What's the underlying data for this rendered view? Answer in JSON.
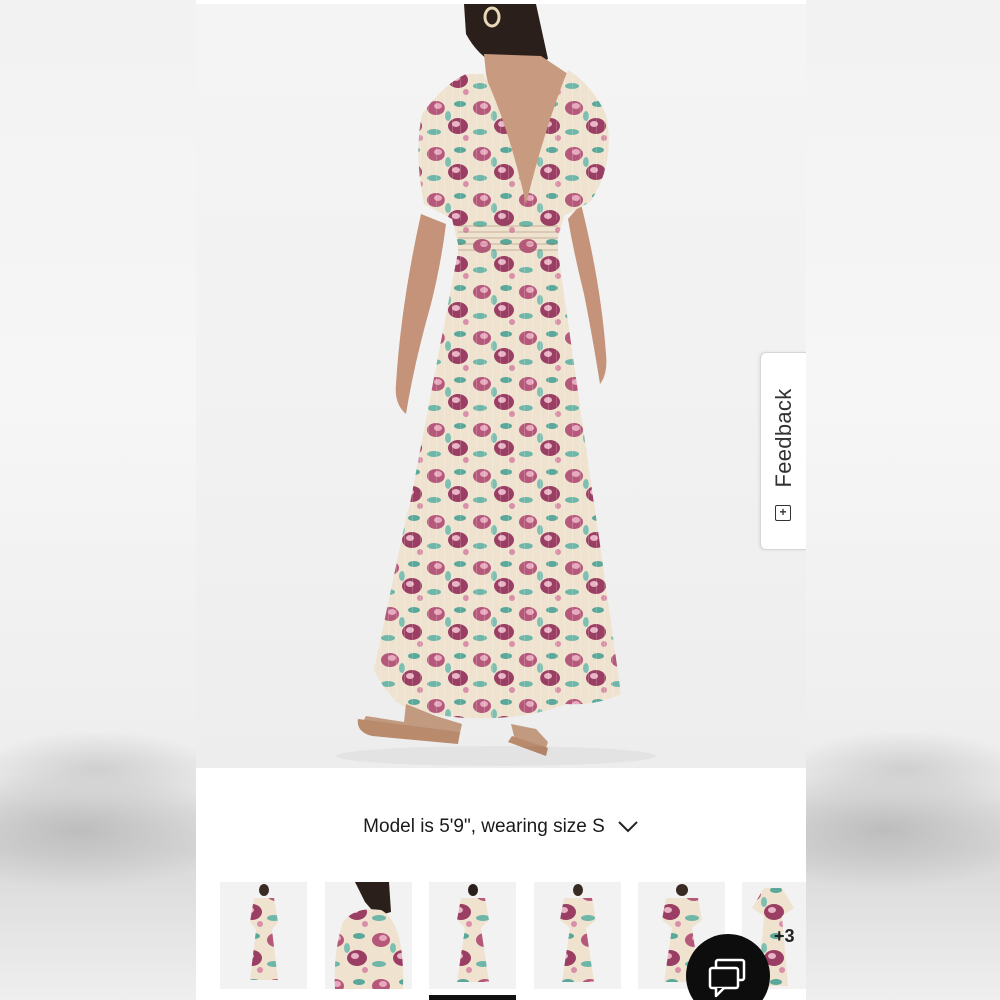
{
  "product_view": {
    "caption": "Model is 5'9\", wearing size S",
    "caption_toggle_icon": "chevron-down-icon",
    "feedback_label": "Feedback",
    "feedback_icon": "plus-square-icon",
    "more_images_badge": "+3",
    "thumbnails": [
      {
        "view": "front-full"
      },
      {
        "view": "side-closeup"
      },
      {
        "view": "back-full",
        "active": true
      },
      {
        "view": "front-full-alt"
      },
      {
        "view": "front-full-plus"
      },
      {
        "view": "flat-lay"
      }
    ],
    "chat_icon": "chat-bubbles-icon"
  },
  "colors": {
    "accent": "#111111",
    "dress_rose": "#b5587a",
    "dress_teal": "#5aa89a",
    "dress_cream": "#efe3cf"
  }
}
